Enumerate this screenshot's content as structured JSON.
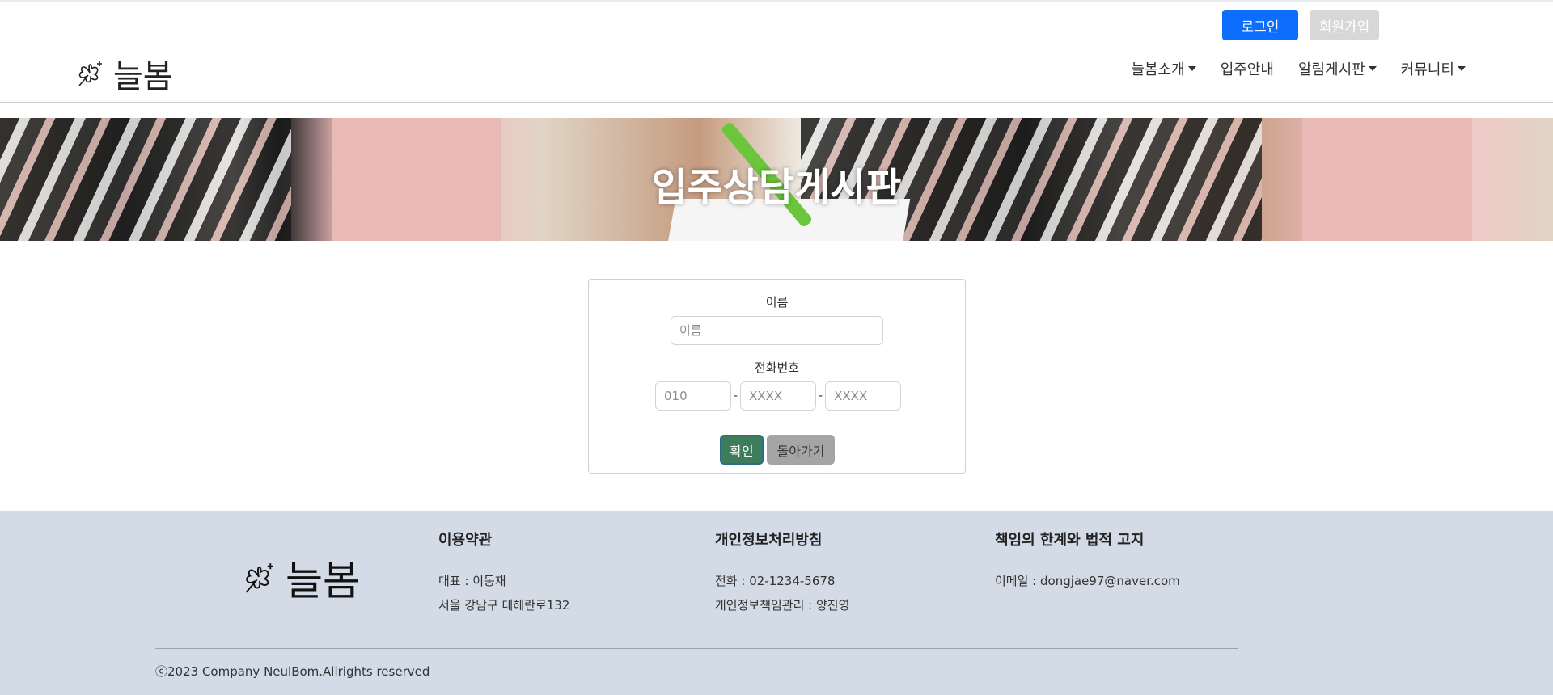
{
  "header": {
    "brand": "늘봄",
    "login_label": "로그인",
    "join_label": "회원가입",
    "nav": [
      {
        "label": "늘봄소개",
        "dropdown": true
      },
      {
        "label": "입주안내",
        "dropdown": false
      },
      {
        "label": "알림게시판",
        "dropdown": true
      },
      {
        "label": "커뮤니티",
        "dropdown": true
      }
    ]
  },
  "banner": {
    "title": "입주상담게시판"
  },
  "form": {
    "name_label": "이름",
    "name_placeholder": "이름",
    "phone_label": "전화번호",
    "phone1_placeholder": "010",
    "phone2_placeholder": "XXXX",
    "phone3_placeholder": "XXXX",
    "separator": "-",
    "confirm_label": "확인",
    "back_label": "돌아가기"
  },
  "footer": {
    "brand": "늘봄",
    "col1": {
      "title": "이용약관",
      "lines": [
        "대표 : 이동재",
        "서울 강남구 테헤란로132"
      ]
    },
    "col2": {
      "title": "개인정보처리방침",
      "lines": [
        "전화 : 02-1234-5678",
        "개인정보책임관리 : 양진영"
      ]
    },
    "col3": {
      "title": "책임의 한계와 법적 고지",
      "lines": [
        "이메일 : dongjae97@naver.com"
      ]
    },
    "copyright": "ⓒ2023 Company NeulBom.Allrights reserved"
  },
  "colors": {
    "login": "#0d6efd",
    "confirm": "#3e7d5b",
    "footer_bg": "#d3dbe6"
  }
}
